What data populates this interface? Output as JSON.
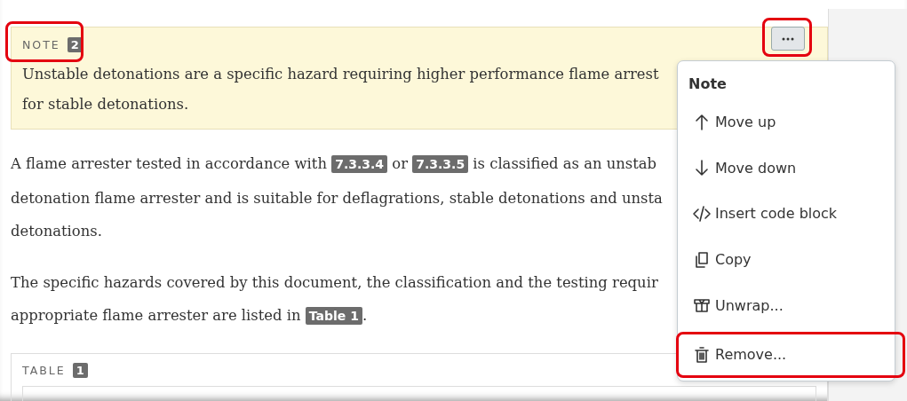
{
  "note": {
    "label": "NOTE",
    "number": "2",
    "highlighted": true,
    "lines": [
      "Unstable detonations are a specific hazard requiring higher performance flame arrest",
      "for stable detonations."
    ]
  },
  "options_button": {
    "highlighted": true
  },
  "paragraphs": [
    {
      "lines": [
        [
          {
            "kind": "text",
            "text": "A flame arrester tested in accordance with "
          },
          {
            "kind": "ref",
            "text": "7.3.3.4"
          },
          {
            "kind": "text",
            "text": " or "
          },
          {
            "kind": "ref",
            "text": "7.3.3.5"
          },
          {
            "kind": "text",
            "text": " is classified as an unstab"
          }
        ],
        [
          {
            "kind": "text",
            "text": "detonation flame arrester and is suitable for deflagrations, stable detonations and unsta"
          }
        ],
        [
          {
            "kind": "text",
            "text": "detonations."
          }
        ]
      ]
    },
    {
      "lines": [
        [
          {
            "kind": "text",
            "text": "The specific hazards covered by this document, the classification and the testing requir"
          }
        ],
        [
          {
            "kind": "text",
            "text": "appropriate flame arrester are listed in "
          },
          {
            "kind": "ref",
            "text": "Table 1"
          },
          {
            "kind": "text",
            "text": "."
          }
        ]
      ]
    }
  ],
  "table": {
    "label": "TABLE",
    "number": "1"
  },
  "menu": {
    "title": "Note",
    "items": [
      {
        "kind": "up",
        "label": "Move up",
        "highlighted": false
      },
      {
        "kind": "down",
        "label": "Move down",
        "highlighted": false
      },
      {
        "kind": "code",
        "label": "Insert code block",
        "highlighted": false
      },
      {
        "kind": "copy",
        "label": "Copy",
        "highlighted": false
      },
      {
        "kind": "unwrap",
        "label": "Unwrap...",
        "highlighted": false
      },
      {
        "kind": "remove",
        "label": "Remove...",
        "highlighted": true
      }
    ]
  }
}
